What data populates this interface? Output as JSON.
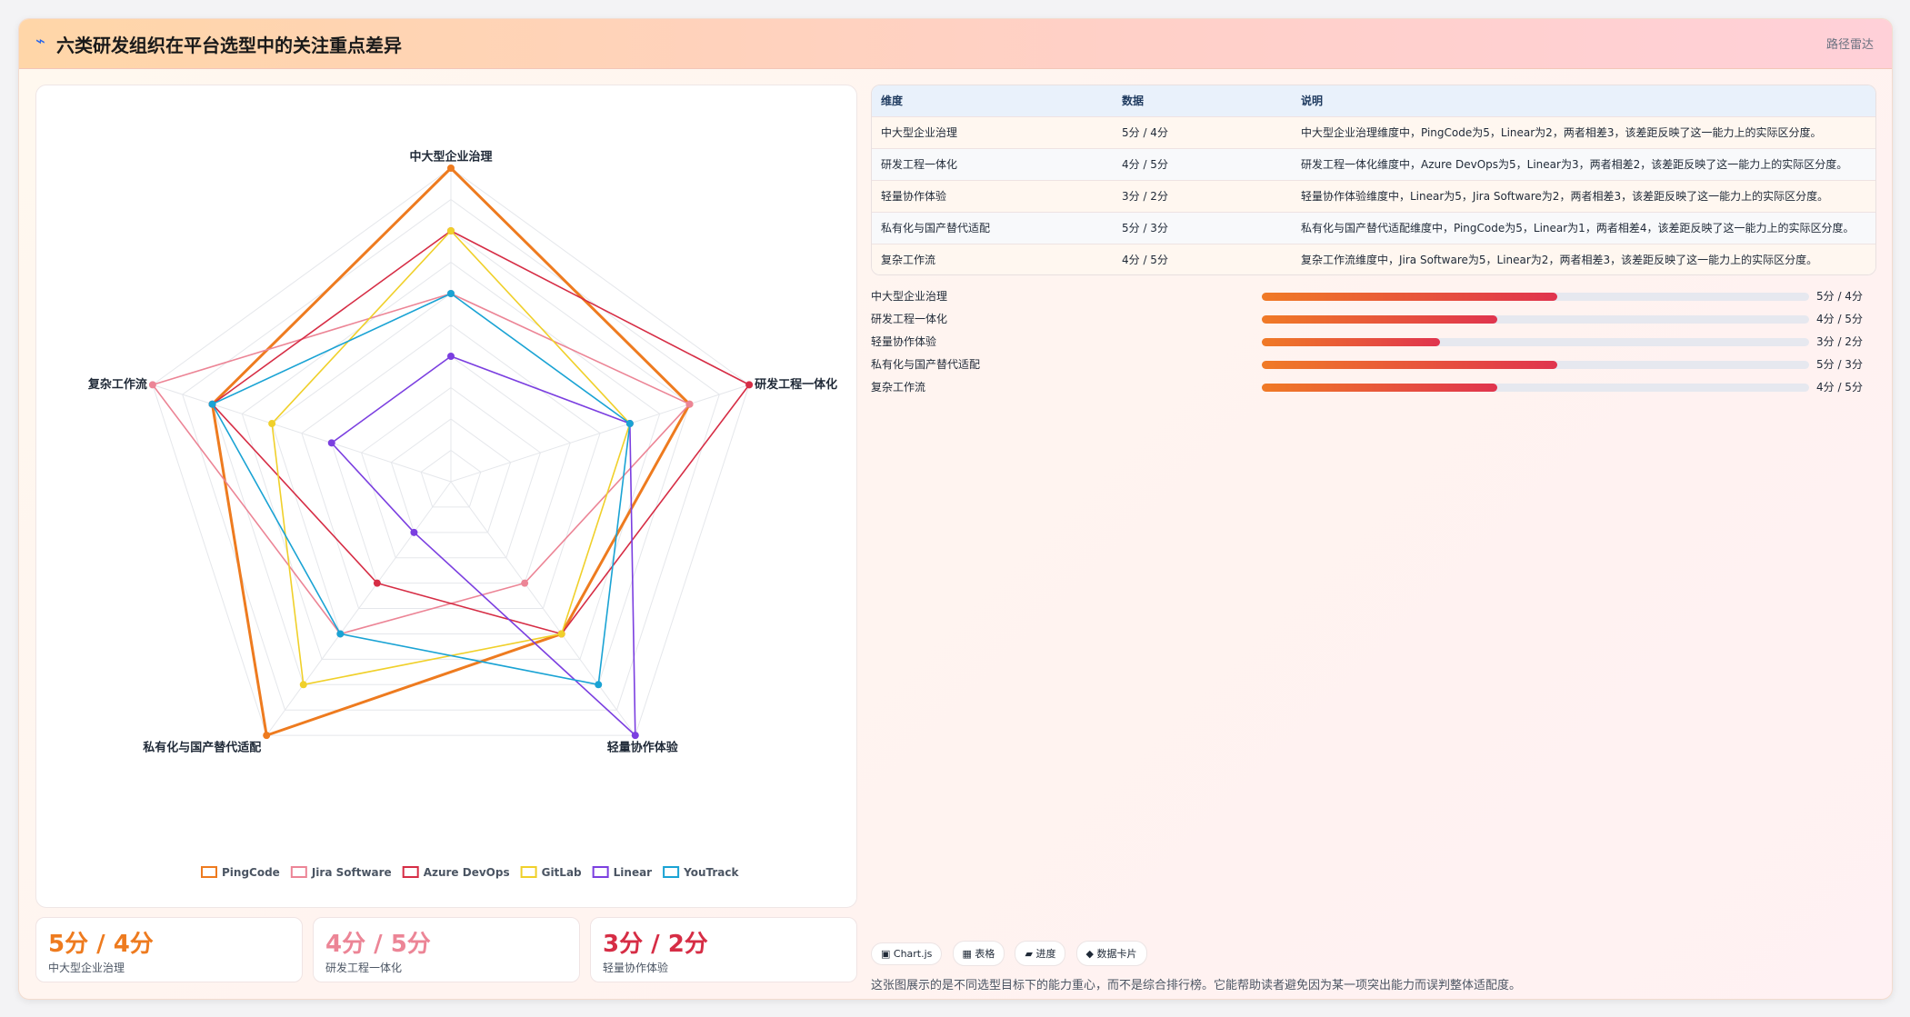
{
  "header": {
    "icon": "bolt-icon",
    "title": "六类研发组织在平台选型中的关注重点差异",
    "tag": "路径雷达"
  },
  "chart_data": {
    "type": "radar",
    "axes": [
      "中大型企业治理",
      "研发工程一体化",
      "轻量协作体验",
      "私有化与国产替代适配",
      "复杂工作流"
    ],
    "range": [
      0,
      5
    ],
    "grid": true,
    "legend": "bottom",
    "series": [
      {
        "name": "PingCode",
        "color": "#ee7b1f",
        "values": [
          5,
          4,
          3,
          5,
          4
        ]
      },
      {
        "name": "Jira Software",
        "color": "#ec8596",
        "values": [
          3,
          4,
          2,
          3,
          5
        ]
      },
      {
        "name": "Azure DevOps",
        "color": "#d62d45",
        "values": [
          4,
          5,
          3,
          2,
          4
        ]
      },
      {
        "name": "GitLab",
        "color": "#f0d02a",
        "values": [
          4,
          3,
          3,
          4,
          3
        ]
      },
      {
        "name": "Linear",
        "color": "#7b3fe0",
        "values": [
          2,
          3,
          5,
          1,
          2
        ]
      },
      {
        "name": "YouTrack",
        "color": "#1aa3d4",
        "values": [
          3,
          3,
          4,
          3,
          4
        ]
      }
    ]
  },
  "table": {
    "headers": [
      "维度",
      "数据",
      "说明"
    ],
    "rows": [
      [
        "中大型企业治理",
        "5分 / 4分",
        "中大型企业治理维度中，PingCode为5，Linear为2，两者相差3，该差距反映了这一能力上的实际区分度。"
      ],
      [
        "研发工程一体化",
        "4分 / 5分",
        "研发工程一体化维度中，Azure DevOps为5，Linear为3，两者相差2，该差距反映了这一能力上的实际区分度。"
      ],
      [
        "轻量协作体验",
        "3分 / 2分",
        "轻量协作体验维度中，Linear为5，Jira Software为2，两者相差3，该差距反映了这一能力上的实际区分度。"
      ],
      [
        "私有化与国产替代适配",
        "5分 / 3分",
        "私有化与国产替代适配维度中，PingCode为5，Linear为1，两者相差4，该差距反映了这一能力上的实际区分度。"
      ],
      [
        "复杂工作流",
        "4分 / 5分",
        "复杂工作流维度中，Jira Software为5，Linear为2，两者相差3，该差距反映了这一能力上的实际区分度。"
      ]
    ]
  },
  "progress": [
    {
      "label": "中大型企业治理",
      "value": "5分 / 4分",
      "fraction": 0.54
    },
    {
      "label": "研发工程一体化",
      "value": "4分 / 5分",
      "fraction": 0.43
    },
    {
      "label": "轻量协作体验",
      "value": "3分 / 2分",
      "fraction": 0.325
    },
    {
      "label": "私有化与国产替代适配",
      "value": "5分 / 3分",
      "fraction": 0.54
    },
    {
      "label": "复杂工作流",
      "value": "4分 / 5分",
      "fraction": 0.43
    }
  ],
  "kpis": [
    {
      "value": "5分 / 4分",
      "label": "中大型企业治理",
      "color": "#ee7b1f"
    },
    {
      "value": "4分 / 5分",
      "label": "研发工程一体化",
      "color": "#ec8596"
    },
    {
      "value": "3分 / 2分",
      "label": "轻量协作体验",
      "color": "#d62d45"
    }
  ],
  "pills": [
    "▣ Chart.js",
    "▦ 表格",
    "▰ 进度",
    "◆ 数据卡片"
  ],
  "footnote": "这张图展示的是不同选型目标下的能力重心，而不是综合排行榜。它能帮助读者避免因为某一项突出能力而误判整体适配度。"
}
